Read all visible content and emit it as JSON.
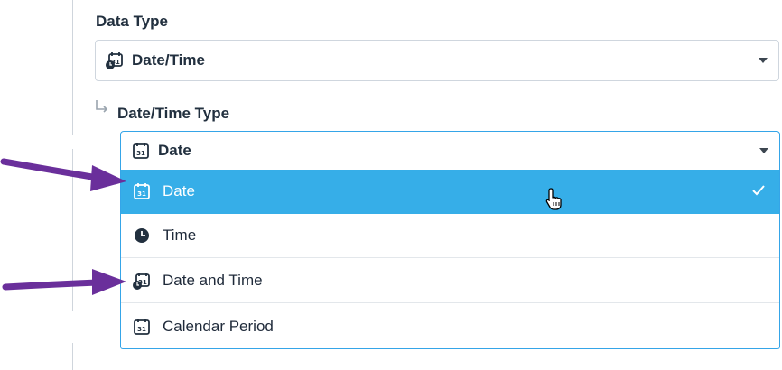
{
  "data_type": {
    "label": "Data Type",
    "value": "Date/Time",
    "icon": "calendar-clock-icon"
  },
  "datetime_type": {
    "label": "Date/Time Type",
    "value": "Date",
    "icon": "calendar-icon"
  },
  "options": [
    {
      "label": "Date",
      "icon": "calendar-icon",
      "selected": true
    },
    {
      "label": "Time",
      "icon": "clock-icon",
      "selected": false
    },
    {
      "label": "Date and Time",
      "icon": "calendar-clock-icon",
      "selected": false
    },
    {
      "label": "Calendar Period",
      "icon": "calendar-icon",
      "selected": false
    }
  ],
  "colors": {
    "selected_bg": "#36aee8",
    "focus_border": "#35a5e8",
    "annotation_arrow": "#6a2f9b"
  }
}
